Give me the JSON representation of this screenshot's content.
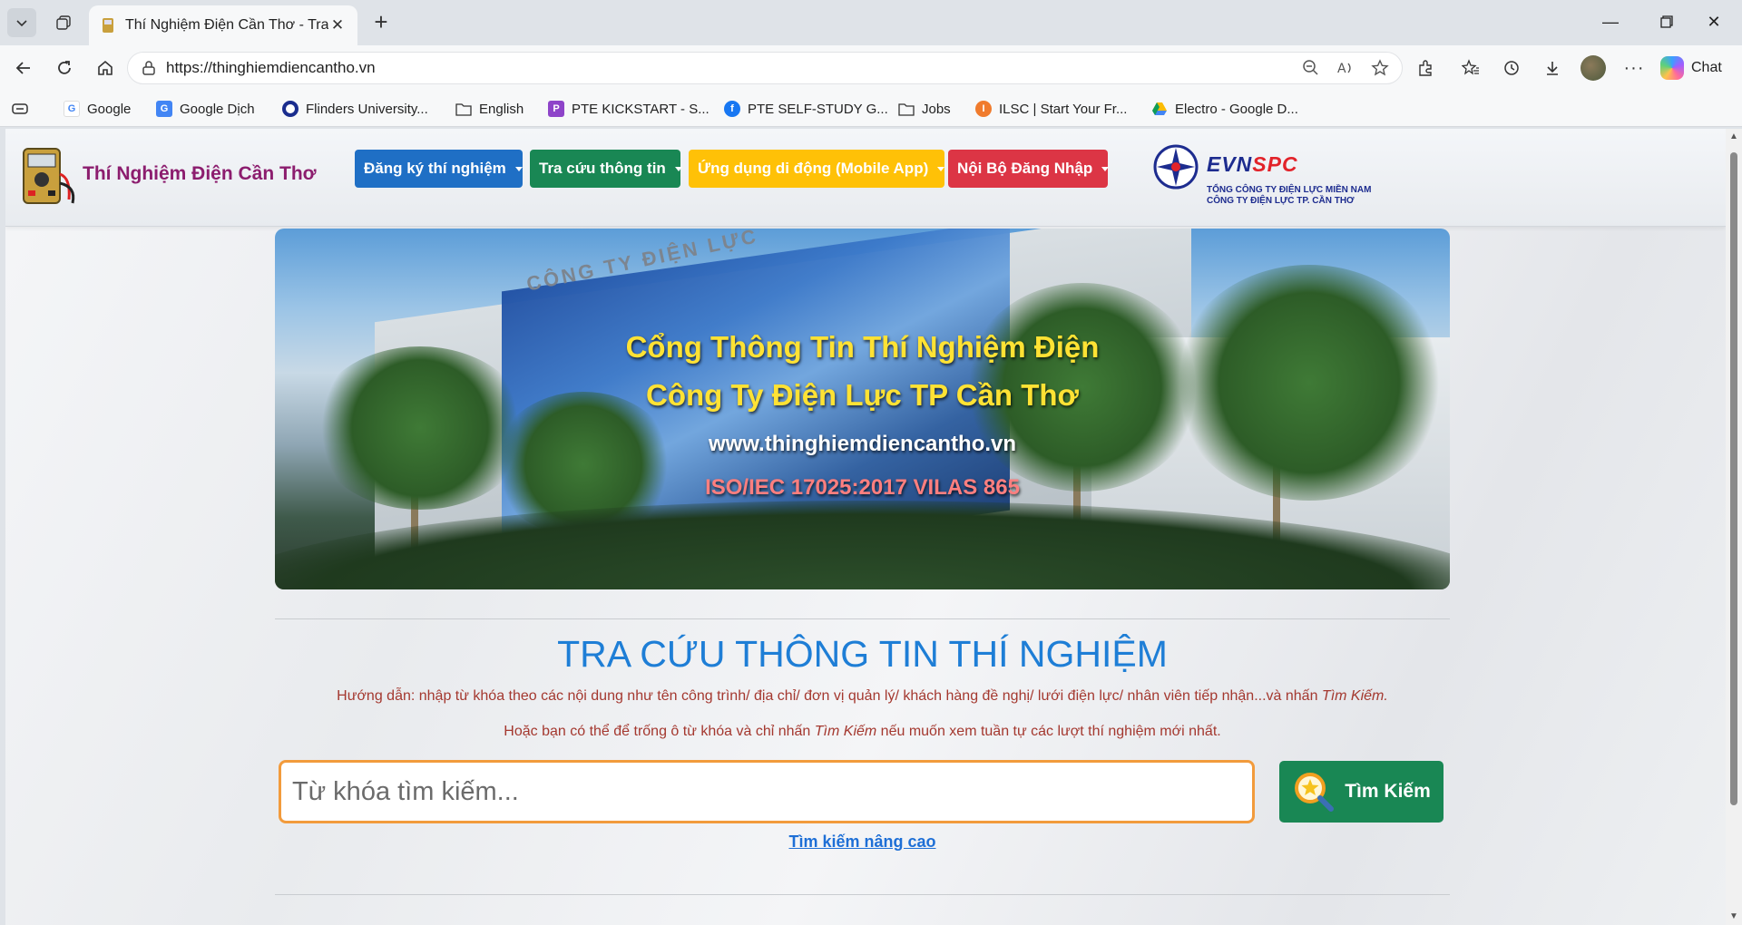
{
  "browser": {
    "tab_title": "Thí Nghiệm Điện Cần Thơ - Trang",
    "url": "https://thinghiemdiencantho.vn",
    "chat_label": "Chat"
  },
  "bookmarks": [
    {
      "label": "Google",
      "icon": "google-icon"
    },
    {
      "label": "Google Dịch",
      "icon": "translate-icon"
    },
    {
      "label": "Flinders University...",
      "icon": "flinders-icon"
    },
    {
      "label": "English",
      "icon": "folder-icon"
    },
    {
      "label": "PTE KICKSTART - S...",
      "icon": "pte-icon"
    },
    {
      "label": "PTE SELF-STUDY G...",
      "icon": "facebook-icon"
    },
    {
      "label": "Jobs",
      "icon": "folder-icon"
    },
    {
      "label": "ILSC | Start Your Fr...",
      "icon": "ilsc-icon"
    },
    {
      "label": "Electro - Google D...",
      "icon": "drive-icon"
    }
  ],
  "site": {
    "name": "Thí Nghiệm Điện Cần Thơ",
    "menu": [
      {
        "label": "Đăng ký thí nghiệm",
        "color": "#1f6fc5"
      },
      {
        "label": "Tra cứu thông tin",
        "color": "#198754"
      },
      {
        "label": "Ứng dụng di động (Mobile App)",
        "color": "#ffc107"
      },
      {
        "label": "Nội Bộ Đăng Nhập",
        "color": "#dc3545"
      }
    ],
    "evn": {
      "brand_a": "EVN",
      "brand_b": "SPC",
      "line1": "TỔNG CÔNG TY ĐIỆN LỰC MIỀN NAM",
      "line2": "CÔNG TY ĐIỆN LỰC TP. CẦN THƠ"
    }
  },
  "banner": {
    "sign": "CÔNG TY ĐIỆN LỰC",
    "line1": "Cổng Thông Tin Thí Nghiệm Điện",
    "line2": "Công Ty Điện Lực TP Cần Thơ",
    "line3": "www.thinghiemdiencantho.vn",
    "line4": "ISO/IEC 17025:2017 VILAS 865"
  },
  "search": {
    "title": "TRA CỨU THÔNG TIN THÍ NGHIỆM",
    "hint1_text": "Hướng dẫn: nhập từ khóa theo các nội dung như tên công trình/ địa chỉ/ đơn vị quản lý/ khách hàng đề nghị/ lưới điện lực/ nhân viên tiếp nhận...và nhấn ",
    "hint1_em": "Tìm Kiếm.",
    "hint2_a": "Hoặc bạn có thể để trống ô từ khóa và chỉ nhấn ",
    "hint2_em": "Tìm Kiếm",
    "hint2_b": " nếu muốn xem tuần tự các lượt thí nghiệm mới nhất.",
    "placeholder": "Từ khóa tìm kiếm...",
    "button": "Tìm Kiếm",
    "advanced": "Tìm kiếm nâng cao"
  }
}
